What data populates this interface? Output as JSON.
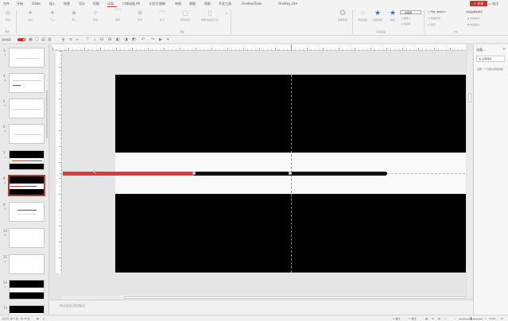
{
  "tabs": [
    {
      "label": "文件",
      "active": false
    },
    {
      "label": "开始",
      "active": false
    },
    {
      "label": "iSlide",
      "active": false
    },
    {
      "label": "插入",
      "active": false
    },
    {
      "label": "绘图",
      "active": false
    },
    {
      "label": "设计",
      "active": false
    },
    {
      "label": "切换",
      "active": false
    },
    {
      "label": "动画",
      "active": true
    },
    {
      "label": "口袋动画 PA",
      "active": false
    },
    {
      "label": "幻灯片放映",
      "active": false
    },
    {
      "label": "审阅",
      "active": false
    },
    {
      "label": "视图",
      "active": false
    },
    {
      "label": "帮助",
      "active": false
    },
    {
      "label": "开发工具",
      "active": false
    },
    {
      "label": "OneKeyTools",
      "active": false
    },
    {
      "label": "OneKey Lite",
      "active": false
    }
  ],
  "share_label": "共享",
  "comment_label": "批注",
  "ribbon": {
    "preview_label": "预览",
    "effects": [
      "淡化",
      "飞入",
      "浮入",
      "劈裂",
      "擦除",
      "形状",
      "轮子",
      "随机线条",
      "翻转式由远及近"
    ],
    "group_preview": "预览",
    "group_animation": "动画",
    "group_advanced": "高级动画",
    "group_timing": "计时",
    "effect_options": "效果选项",
    "add_animation": "添加动画",
    "animation_pane": "动画窗格",
    "trigger": "触发",
    "animation_painter": "动画刷",
    "start_label": "开始:",
    "start_value": "单击时",
    "duration_label": "持续时间:",
    "delay_label": "延迟:",
    "reorder_label": "对动画重新排序",
    "move_earlier": "向前移动",
    "move_later": "向后移动"
  },
  "quick_access": {
    "autosave_label": "自动保存"
  },
  "slides": [
    {
      "num": "3",
      "variant": "white-lines"
    },
    {
      "num": "4",
      "variant": "white-lines"
    },
    {
      "num": "5",
      "variant": "white-lines"
    },
    {
      "num": "6",
      "variant": "white-lines"
    },
    {
      "num": "7",
      "variant": "black-band"
    },
    {
      "num": "8",
      "variant": "black-band-selected"
    },
    {
      "num": "9",
      "variant": "white-dark-lines"
    },
    {
      "num": "10",
      "variant": "white"
    },
    {
      "num": "11",
      "variant": "white"
    },
    {
      "num": "12",
      "variant": "black-band"
    },
    {
      "num": "13",
      "variant": "black-band"
    }
  ],
  "notes_placeholder": "单击此处添加备注",
  "animation_pane": {
    "title": "动画...",
    "play_button": "全部播放",
    "hint": "选择一个对象并添加动画"
  },
  "status_bar": {
    "slide_info": "幻灯片 第 8 张，共 25 张",
    "notes": "备注",
    "comments": "批注",
    "zoom_level": "100%"
  },
  "colors": {
    "accent": "#c0392b",
    "red_bar": "#c74343",
    "canvas": "#000000"
  }
}
